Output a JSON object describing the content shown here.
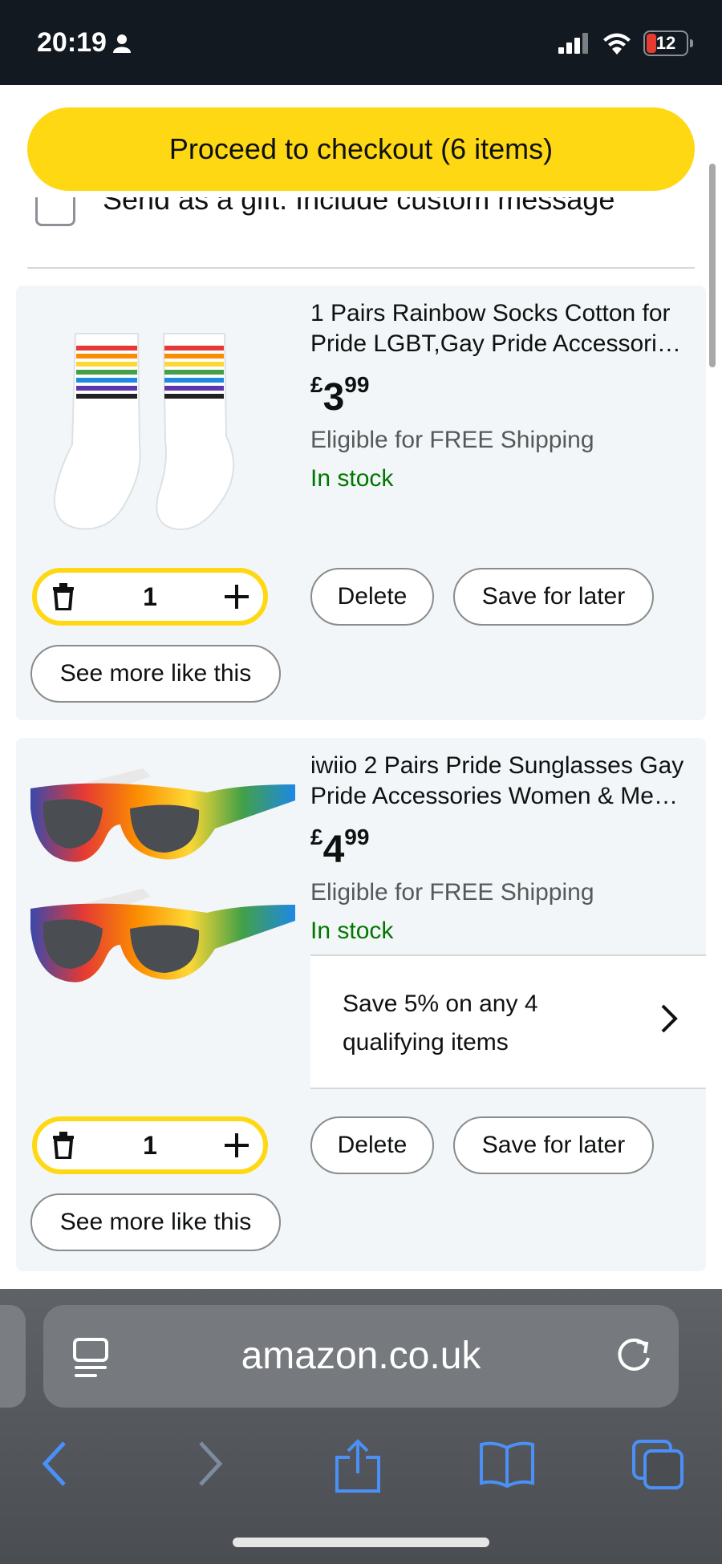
{
  "status_bar": {
    "time": "20:19",
    "battery": "12"
  },
  "checkout": {
    "label": "Proceed to checkout (6 items)"
  },
  "gift": {
    "label": "Send as a gift. Include custom message"
  },
  "items": [
    {
      "title_line1": "1 Pairs Rainbow Socks Cotton for",
      "title_line2": "Pride LGBT,Gay Pride Accessori…",
      "price_symbol": "£",
      "price_whole": "3",
      "price_fraction": "99",
      "shipping": "Eligible for FREE Shipping",
      "stock": "In stock",
      "quantity": "1",
      "delete_label": "Delete",
      "save_label": "Save for later",
      "see_more_label": "See more like this"
    },
    {
      "title_line1": "iwiio 2 Pairs Pride Sunglasses Gay",
      "title_line2": "Pride Accessories Women & Me…",
      "price_symbol": "£",
      "price_whole": "4",
      "price_fraction": "99",
      "shipping": "Eligible for FREE Shipping",
      "stock": "In stock",
      "promo_line1": "Save 5% on any 4",
      "promo_line2": "qualifying items",
      "quantity": "1",
      "delete_label": "Delete",
      "save_label": "Save for later",
      "see_more_label": "See more like this"
    }
  ],
  "browser": {
    "url": "amazon.co.uk"
  },
  "colors": {
    "checkout_yellow": "#ffd814",
    "stock_green": "#007600",
    "ios_blue": "#4a90f7"
  }
}
